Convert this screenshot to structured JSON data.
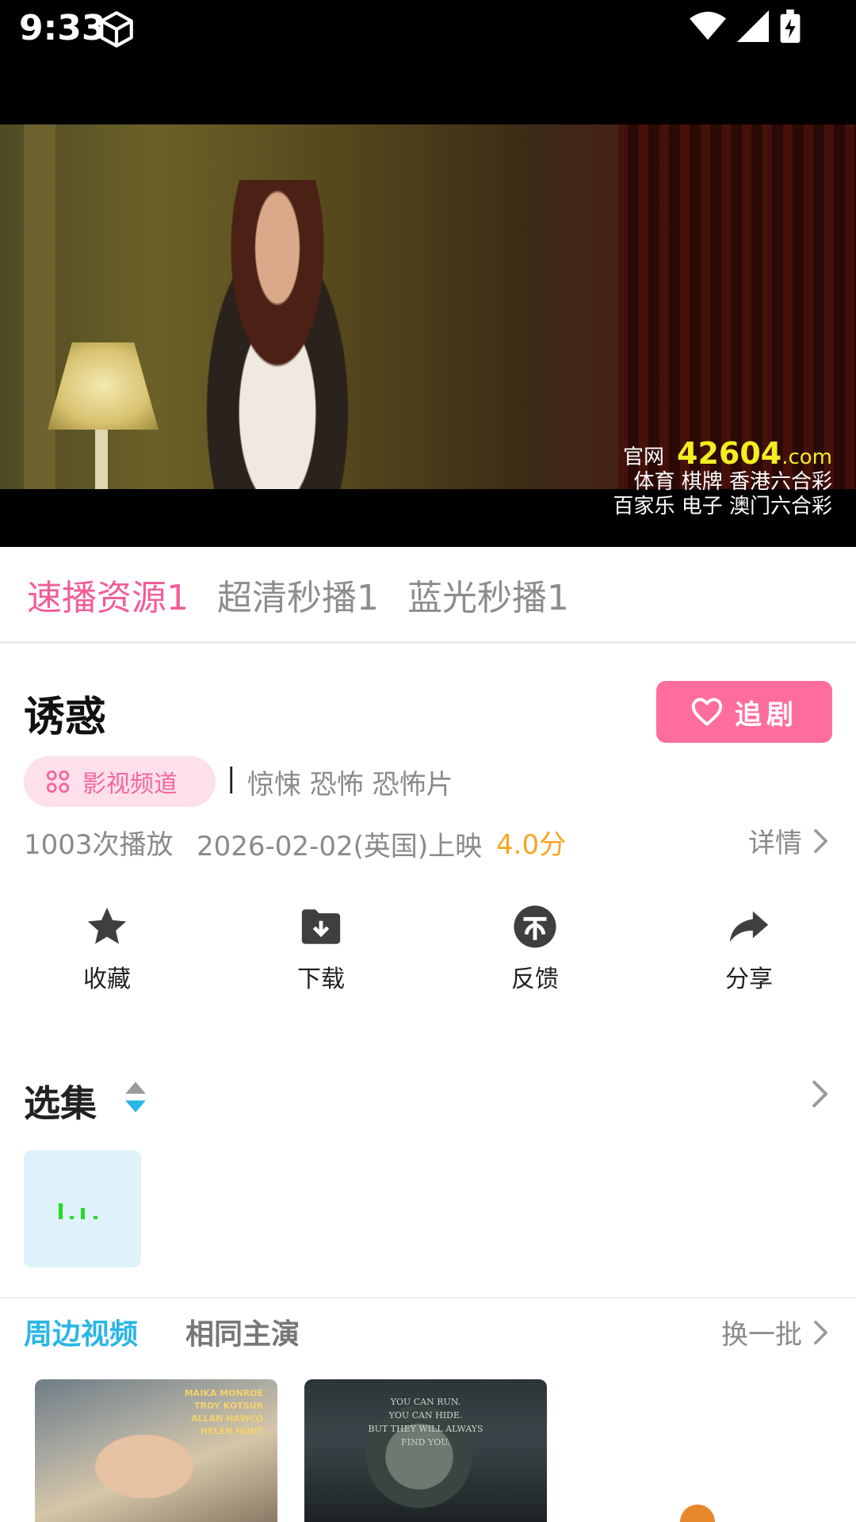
{
  "status_bar": {
    "time": "9:33"
  },
  "video": {
    "watermark": {
      "official_label": "官网",
      "number": "42604",
      "domain": ".com",
      "line2": "体育 棋牌 香港六合彩",
      "line3": "百家乐  电子  澳门六合彩"
    }
  },
  "source_tabs": [
    "速播资源1",
    "超清秒播1",
    "蓝光秒播1"
  ],
  "movie": {
    "title": "诱惑",
    "follow_label": "追剧",
    "channel": "影视频道",
    "separator": "|",
    "genres": "惊悚 恐怖 恐怖片",
    "plays": "1003次播放",
    "release": "2026-02-02(英国)上映",
    "rating": "4.0分",
    "detail": "详情"
  },
  "actions": [
    {
      "label": "收藏",
      "icon": "star-icon"
    },
    {
      "label": "下载",
      "icon": "download-folder-icon"
    },
    {
      "label": "反馈",
      "icon": "feedback-icon"
    },
    {
      "label": "分享",
      "icon": "share-icon"
    }
  ],
  "episodes": {
    "title": "选集"
  },
  "related": {
    "tabs": [
      "周边视频",
      "相同主演"
    ],
    "refresh": "换一批",
    "posters": [
      {
        "credits": [
          "MAIKA MONROE",
          "TROY KOTSUR",
          "ALLAN HAWCO",
          "HELEN HUNT"
        ]
      },
      {
        "tagline": [
          "YOU CAN RUN.",
          "YOU CAN HIDE.",
          "BUT THEY WILL ALWAYS",
          "FIND YOU."
        ]
      }
    ]
  },
  "colors": {
    "accent_pink": "#ff6d9f",
    "active_tab_pink": "#f25d98",
    "rating_orange": "#f5a623",
    "related_active_blue": "#2ab6e6",
    "watermark_yellow": "#f2ee21"
  }
}
